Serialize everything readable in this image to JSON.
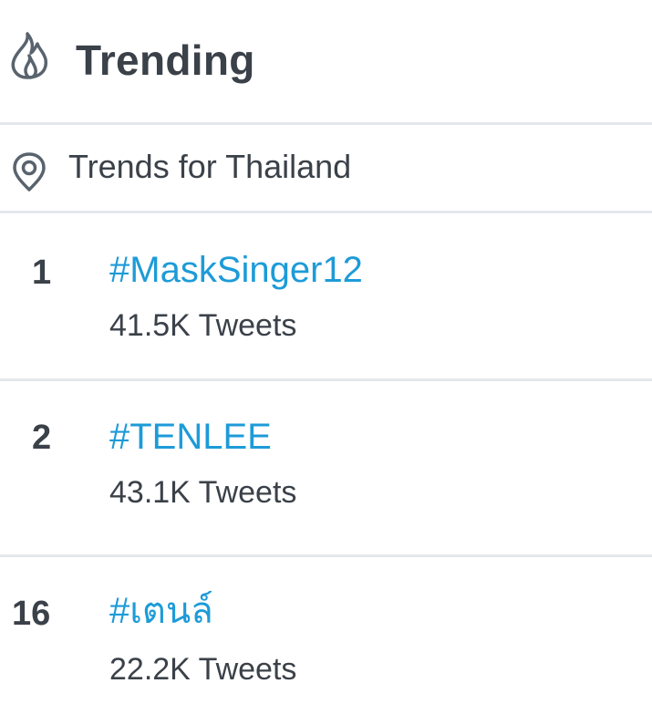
{
  "header": {
    "title": "Trending",
    "icon": "flame-icon"
  },
  "location": {
    "label": "Trends for Thailand",
    "icon": "location-pin-icon"
  },
  "trends": [
    {
      "rank": "1",
      "tag": "#MaskSinger12",
      "count": "41.5K Tweets"
    },
    {
      "rank": "2",
      "tag": "#TENLEE",
      "count": "43.1K Tweets"
    },
    {
      "rank": "16",
      "tag": "#เตนล์",
      "count": "22.2K Tweets"
    }
  ],
  "colors": {
    "accent": "#1d9bd8",
    "text": "#3b4149",
    "divider": "#e4e8ec",
    "icon": "#59636e"
  }
}
